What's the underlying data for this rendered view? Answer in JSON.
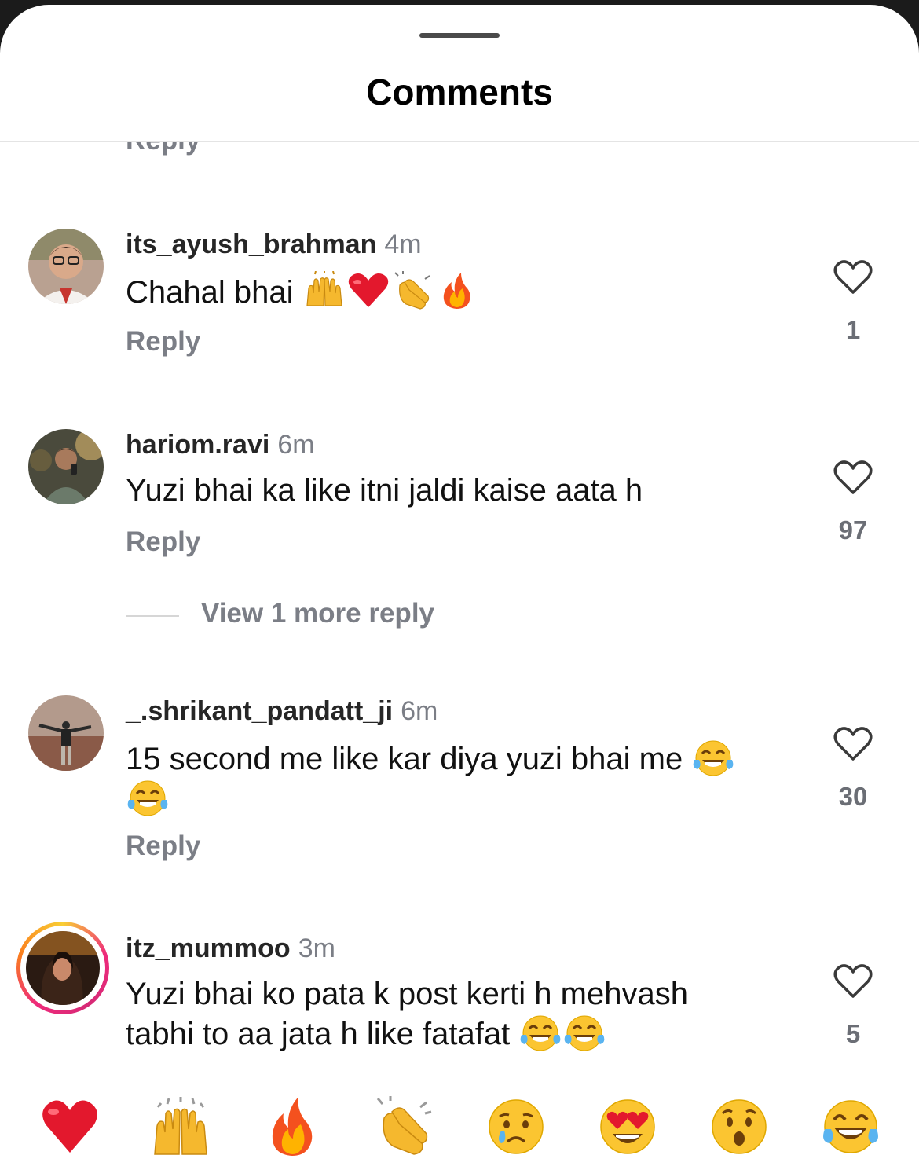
{
  "sheet": {
    "title": "Comments"
  },
  "clipped_reply_label": "Reply",
  "comments": [
    {
      "username": "its_ayush_brahman",
      "time": "4m",
      "text": "Chahal bhai",
      "text_emojis": [
        "raising-hands",
        "red-heart",
        "clapping-hands",
        "fire"
      ],
      "reply_label": "Reply",
      "likes": "1"
    },
    {
      "username": "hariom.ravi",
      "time": "6m",
      "text": "Yuzi bhai ka like itni jaldi kaise aata h",
      "reply_label": "Reply",
      "likes": "97",
      "view_more": "View 1 more reply"
    },
    {
      "username": "_.shrikant_pandatt_ji",
      "time": "6m",
      "text": "15 second me like kar diya yuzi bhai me",
      "text_emojis": [
        "tears-of-joy",
        "tears-of-joy"
      ],
      "reply_label": "Reply",
      "likes": "30"
    },
    {
      "username": "itz_mummoo",
      "time": "3m",
      "text": "Yuzi bhai ko pata k post kerti h mehvash tabhi to aa jata h like fatafat",
      "text_emojis": [
        "tears-of-joy",
        "tears-of-joy"
      ],
      "likes": "5",
      "has_story_ring": true
    }
  ],
  "reaction_bar": [
    "red-heart",
    "raising-hands",
    "fire",
    "clapping-hands",
    "crying-face",
    "heart-eyes",
    "surprised-face",
    "tears-of-joy"
  ],
  "colors": {
    "secondary_text": "#7b7e86",
    "story_ring": [
      "#f9ce34",
      "#ee2a7b",
      "#6228d7"
    ]
  }
}
